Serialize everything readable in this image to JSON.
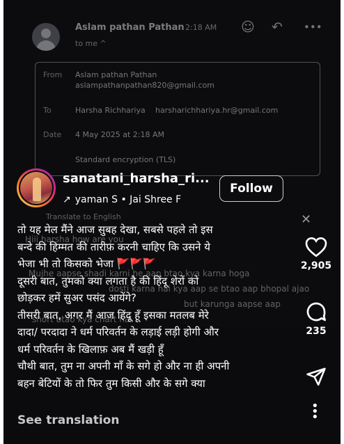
{
  "email": {
    "sender": "Aslam pathan Pathan",
    "time": "2:18 AM",
    "to_me": "to me ^",
    "details": {
      "from_label": "From",
      "from_name": "Aslam pathan Pathan",
      "from_email": "aslampathanpathan820@gmail.com",
      "to_label": "To",
      "to_name": "Harsha Richhariya",
      "to_email": "harsharichhariya.hr@gmail.com",
      "date_label": "Date",
      "date_value": "4 May 2025 at 2:18 AM",
      "encryption": "Standard encryption (TLS)"
    },
    "translate": "Translate to English",
    "body_lines": [
      "Hiii harsha how are you",
      "Mujhe aapse shadi karni he aap btao kya karna hoga",
      "dosti karna hai kya aap se btao aap bhopal ajao",
      "but karunga aapse aap",
      "short btao kya chart hai"
    ]
  },
  "reel": {
    "username": "sanatani_harsha_ri...",
    "audio": "уаman S • Jai Shree F",
    "follow_label": "Follow",
    "close_label": "✕",
    "caption_lines": [
      "तो यह मेल मैंने आज सुबह देखा, सबसे पहले तो इस",
      "बन्दे की हिम्मत की तारीफ़ करनी चाहिए कि उसने ये",
      "भेजा भी तो किसको भेजा",
      "दूसरी बात, तुमको क्या लगता है की हिंदू शेरों को",
      "छोड़कर हमें सुअर पसंद आयेंगे?",
      "तीसरी बात, अगर मैं आज हिंदू हूँ इसका मतलब मेरे",
      "दादा/ परदादा ने धर्म परिवर्तन के लड़ाई लड़ी होगी और",
      "धर्म परिवर्तन के खिलाफ़ अब मैं खड़ी हूँ",
      "चौथी बात, तुम ना अपनी माँ के सगे हो और ना ही अपनी",
      "बहन बेटियों के तो फिर तुम किसी और के सगे क्या"
    ],
    "flags": "🚩🚩🚩",
    "see_translation": "See translation",
    "likes": "2,905",
    "comments": "235",
    "accent_color": "#e53935"
  }
}
